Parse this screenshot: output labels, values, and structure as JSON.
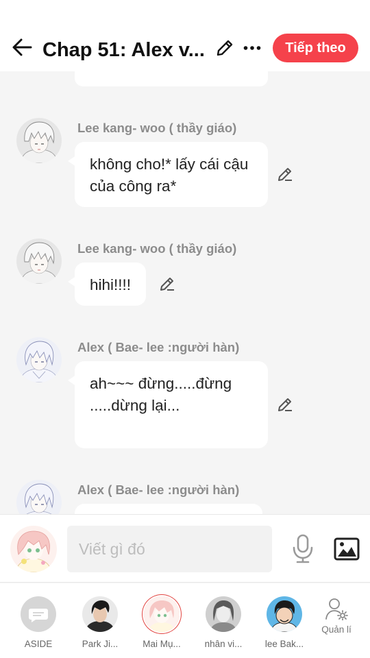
{
  "header": {
    "title": "Chap 51: Alex v...",
    "next_label": "Tiếp theo"
  },
  "messages": [
    {
      "sender": "Lee kang- woo ( thầy giáo)",
      "text": " không cho!* lấy cái cậu của công ra*",
      "avatar": "white-haired-boy"
    },
    {
      "sender": "Lee kang- woo ( thầy giáo)",
      "text": "hihi!!!!",
      "avatar": "white-haired-boy"
    },
    {
      "sender": "Alex (  Bae- lee :người hàn)",
      "text": "ah~~~ đừng.....đừng .....dừng lại...",
      "avatar": "silver-haired-boy"
    },
    {
      "sender": "Alex (  Bae- lee :người hàn)",
      "text": "",
      "avatar": "silver-haired-boy"
    }
  ],
  "composer": {
    "placeholder": "Viết gì đó",
    "mic_icon": "microphone-icon",
    "image_icon": "image-icon"
  },
  "characters": [
    {
      "name": "ASIDE",
      "avatar": "chat-bubble-icon"
    },
    {
      "name": "Park Ji...",
      "avatar": "dark-haired-man"
    },
    {
      "name": "Mai Mụ...",
      "avatar": "pink-haired-girl"
    },
    {
      "name": "nhân vi...",
      "avatar": "grayscale-woman"
    },
    {
      "name": "lee Bak...",
      "avatar": "cartoon-boy"
    }
  ],
  "manage": {
    "label": "Quản lí",
    "icon": "user-settings-icon"
  },
  "colors": {
    "accent": "#f5424b",
    "bubble": "#ffffff",
    "background": "#f5f5f5",
    "sender": "#8c8c8c"
  }
}
